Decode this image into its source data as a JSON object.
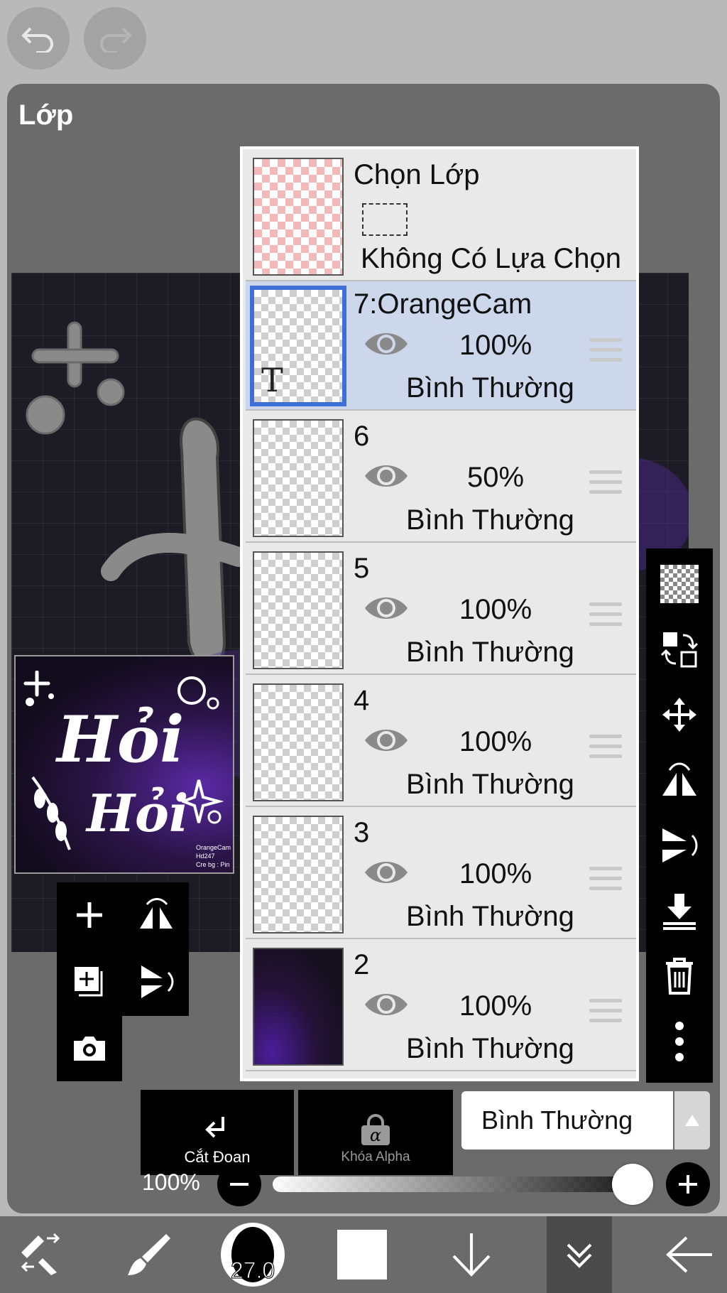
{
  "panel": {
    "title": "Lớp"
  },
  "selection_layer": {
    "title": "Chọn Lớp",
    "status": "Không Có Lựa Chọn"
  },
  "layers": [
    {
      "name": "7:OrangeCam",
      "opacity": "100%",
      "blend": "Bình Thường",
      "selected": true,
      "text_marker": "T"
    },
    {
      "name": "6",
      "opacity": "50%",
      "blend": "Bình Thường"
    },
    {
      "name": "5",
      "opacity": "100%",
      "blend": "Bình Thường"
    },
    {
      "name": "4",
      "opacity": "100%",
      "blend": "Bình Thường"
    },
    {
      "name": "3",
      "opacity": "100%",
      "blend": "Bình Thường"
    },
    {
      "name": "2",
      "opacity": "100%",
      "blend": "Bình Thường"
    }
  ],
  "controls": {
    "clip_label": "Cắt Đoạn",
    "alpha_lock_label": "Khóa Alpha",
    "alpha_glyph": "α",
    "blend_mode": "Bình Thường",
    "opacity_label": "100%",
    "opacity_value": 1.0
  },
  "toolbar": {
    "brush_size": "27.0"
  },
  "preview": {
    "title_line1": "Hỏi",
    "title_line2": "Hỏi",
    "credit": [
      "OrangeCam",
      "Hd247",
      "Cre bg : Pin"
    ]
  },
  "colors": {
    "accent": "#3d6fd6",
    "selected_row": "#cdd7ec",
    "panel": "#6b6b6b"
  }
}
